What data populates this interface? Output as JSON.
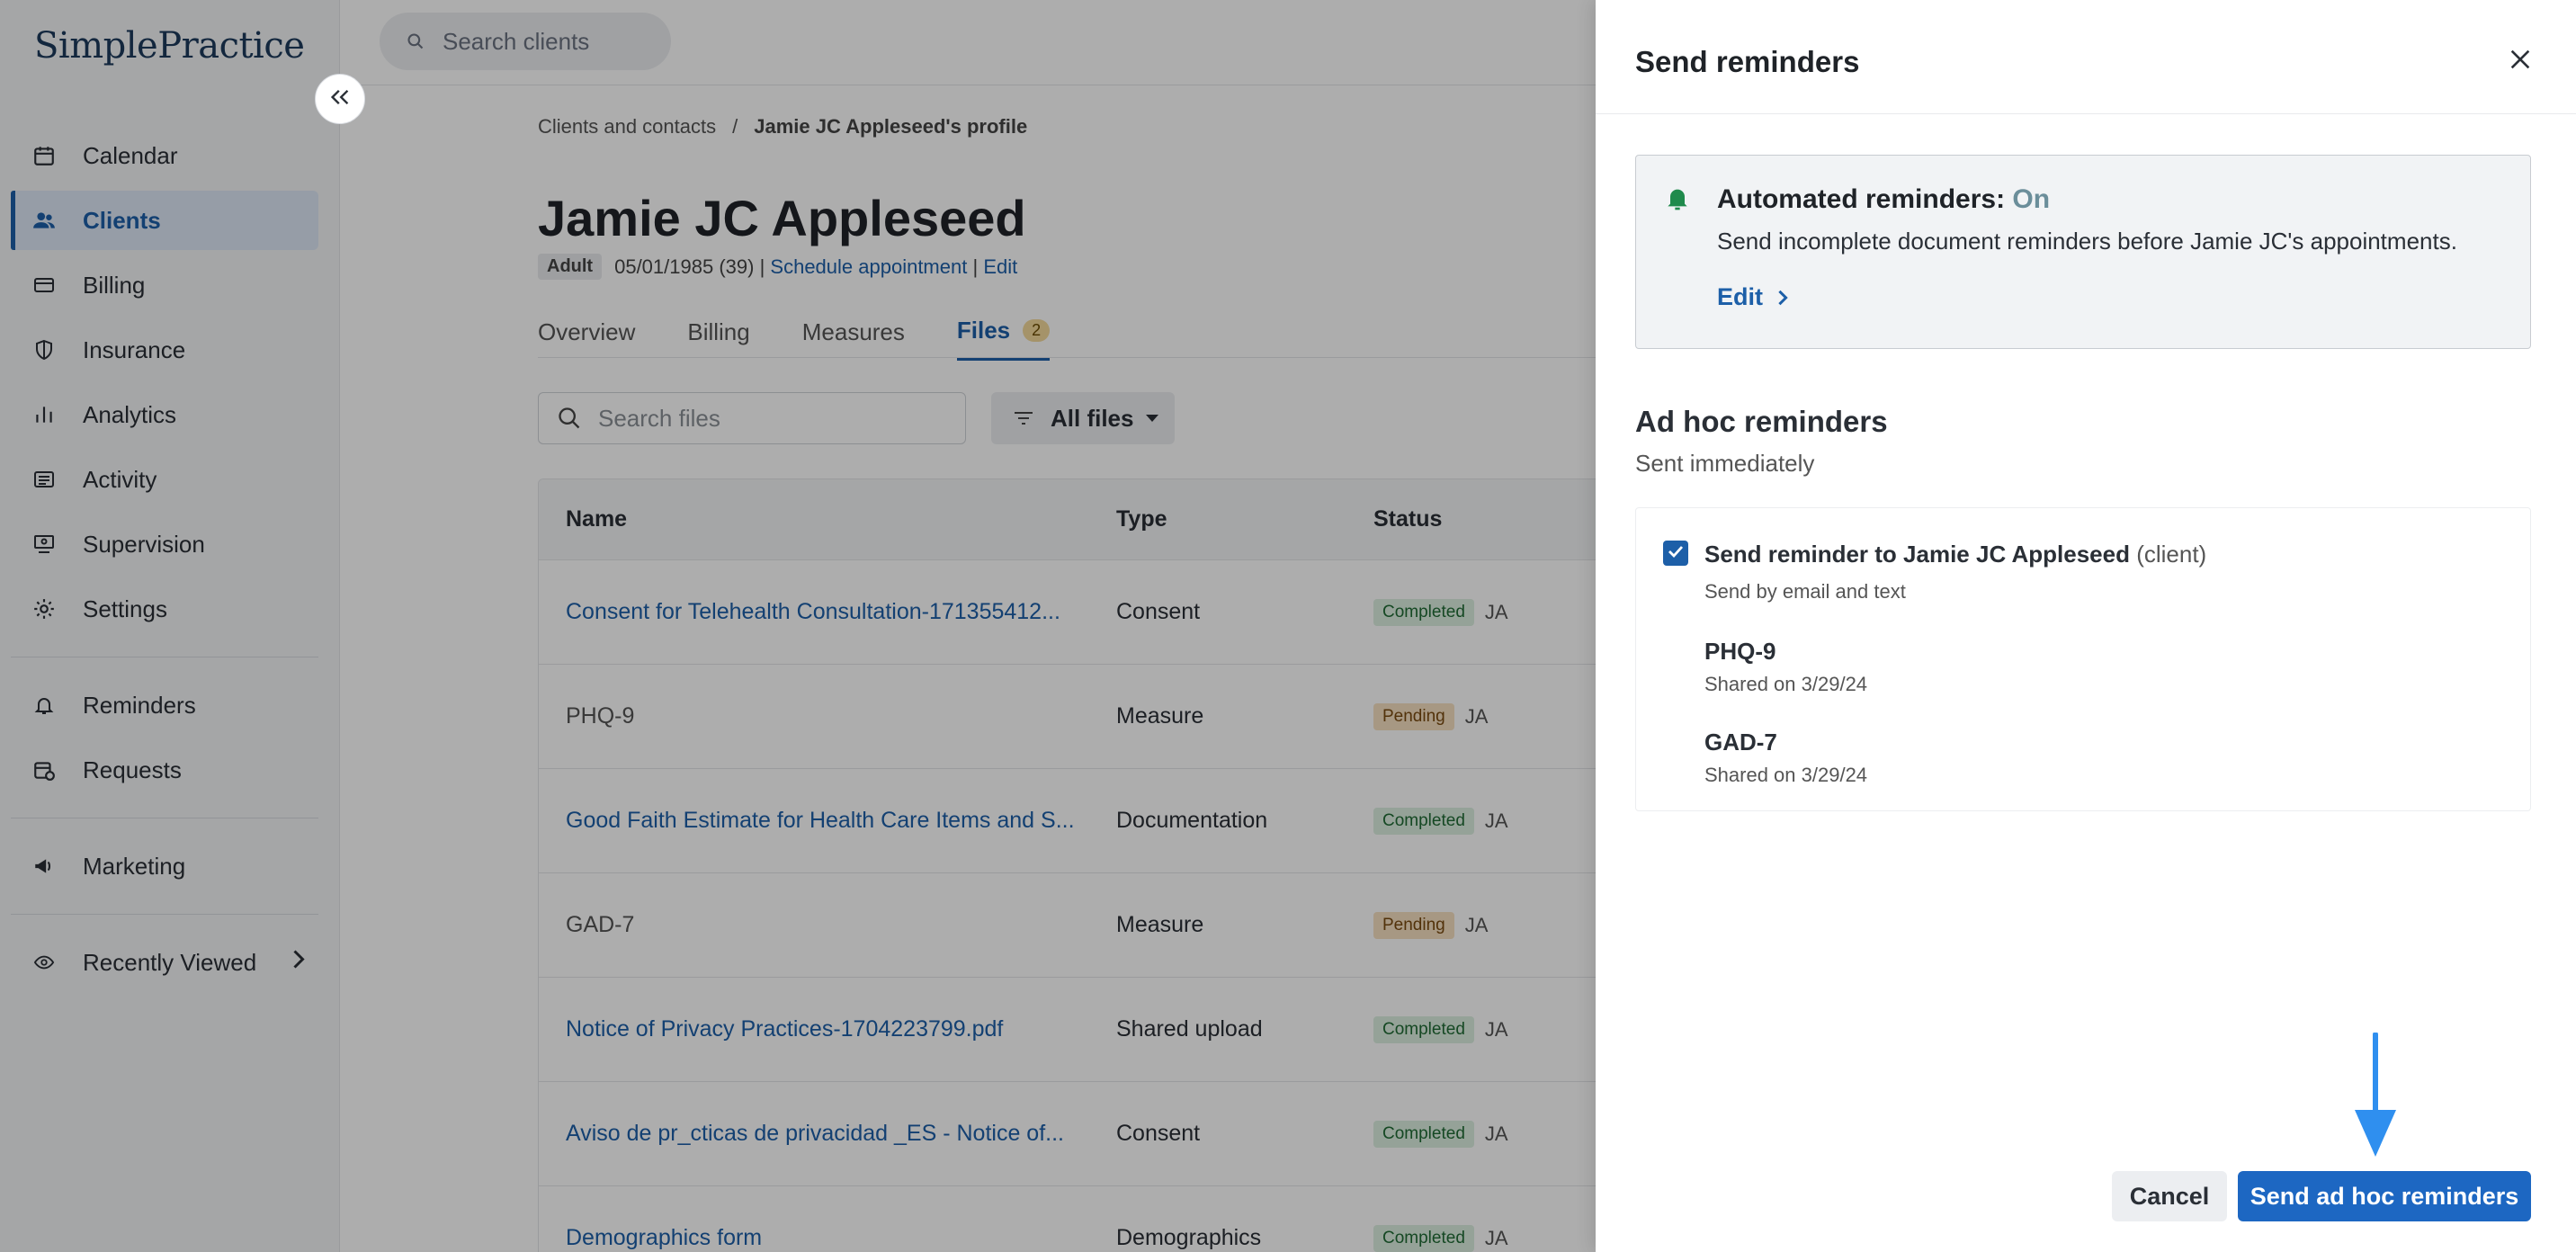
{
  "app": {
    "logo": "SimplePractice"
  },
  "search": {
    "placeholder": "Search clients"
  },
  "sidebar": {
    "items": [
      {
        "label": "Calendar",
        "icon": "calendar-icon"
      },
      {
        "label": "Clients",
        "icon": "clients-icon",
        "active": true
      },
      {
        "label": "Billing",
        "icon": "billing-icon"
      },
      {
        "label": "Insurance",
        "icon": "shield-icon"
      },
      {
        "label": "Analytics",
        "icon": "analytics-icon"
      },
      {
        "label": "Activity",
        "icon": "activity-icon"
      },
      {
        "label": "Supervision",
        "icon": "supervision-icon"
      },
      {
        "label": "Settings",
        "icon": "gear-icon"
      },
      {
        "label": "Reminders",
        "icon": "bell-icon"
      },
      {
        "label": "Requests",
        "icon": "requests-icon"
      },
      {
        "label": "Marketing",
        "icon": "megaphone-icon"
      },
      {
        "label": "Recently Viewed",
        "icon": "eye-icon"
      }
    ]
  },
  "breadcrumb": {
    "parent": "Clients and contacts",
    "separator": "/",
    "current": "Jamie JC Appleseed's profile"
  },
  "client": {
    "name": "Jamie JC Appleseed",
    "badge": "Adult",
    "dob": "05/01/1985 (39)",
    "divider": "|",
    "schedule": "Schedule appointment",
    "edit": "Edit"
  },
  "tabs": [
    {
      "label": "Overview"
    },
    {
      "label": "Billing"
    },
    {
      "label": "Measures"
    },
    {
      "label": "Files",
      "count": "2",
      "active": true
    }
  ],
  "files": {
    "search_placeholder": "Search files",
    "filter_label": "All files",
    "columns": {
      "name": "Name",
      "type": "Type",
      "status": "Status"
    },
    "rows": [
      {
        "name": "Consent for Telehealth Consultation-171355412...",
        "type": "Consent",
        "status": "Completed",
        "initials": "JA",
        "link": true
      },
      {
        "name": "PHQ-9",
        "type": "Measure",
        "status": "Pending",
        "initials": "JA",
        "link": false
      },
      {
        "name": "Good Faith Estimate for Health Care Items and S...",
        "type": "Documentation",
        "status": "Completed",
        "initials": "JA",
        "link": true
      },
      {
        "name": "GAD-7",
        "type": "Measure",
        "status": "Pending",
        "initials": "JA",
        "link": false
      },
      {
        "name": "Notice of Privacy Practices-1704223799.pdf",
        "type": "Shared upload",
        "status": "Completed",
        "initials": "JA",
        "link": true
      },
      {
        "name": "Aviso de pr_cticas de privacidad _ES - Notice of...",
        "type": "Consent",
        "status": "Completed",
        "initials": "JA",
        "link": true
      },
      {
        "name": "Demographics form",
        "type": "Demographics",
        "status": "Completed",
        "initials": "JA",
        "link": true
      }
    ]
  },
  "panel": {
    "title": "Send reminders",
    "auto": {
      "title": "Automated reminders:",
      "state": "On",
      "description": "Send incomplete document reminders before Jamie JC's appointments.",
      "edit": "Edit"
    },
    "adhoc": {
      "title": "Ad hoc reminders",
      "subtitle": "Sent immediately",
      "recipient_label": "Send reminder to Jamie JC Appleseed",
      "recipient_role": "(client)",
      "method": "Send by email and text",
      "checked": true,
      "docs": [
        {
          "name": "PHQ-9",
          "shared": "Shared on 3/29/24"
        },
        {
          "name": "GAD-7",
          "shared": "Shared on 3/29/24"
        }
      ]
    },
    "cancel": "Cancel",
    "send": "Send ad hoc reminders"
  },
  "colors": {
    "primary": "#1d67c2",
    "link": "#1d5fa8",
    "success_bell": "#1f8a4c",
    "annotation_arrow": "#2f8fef"
  }
}
